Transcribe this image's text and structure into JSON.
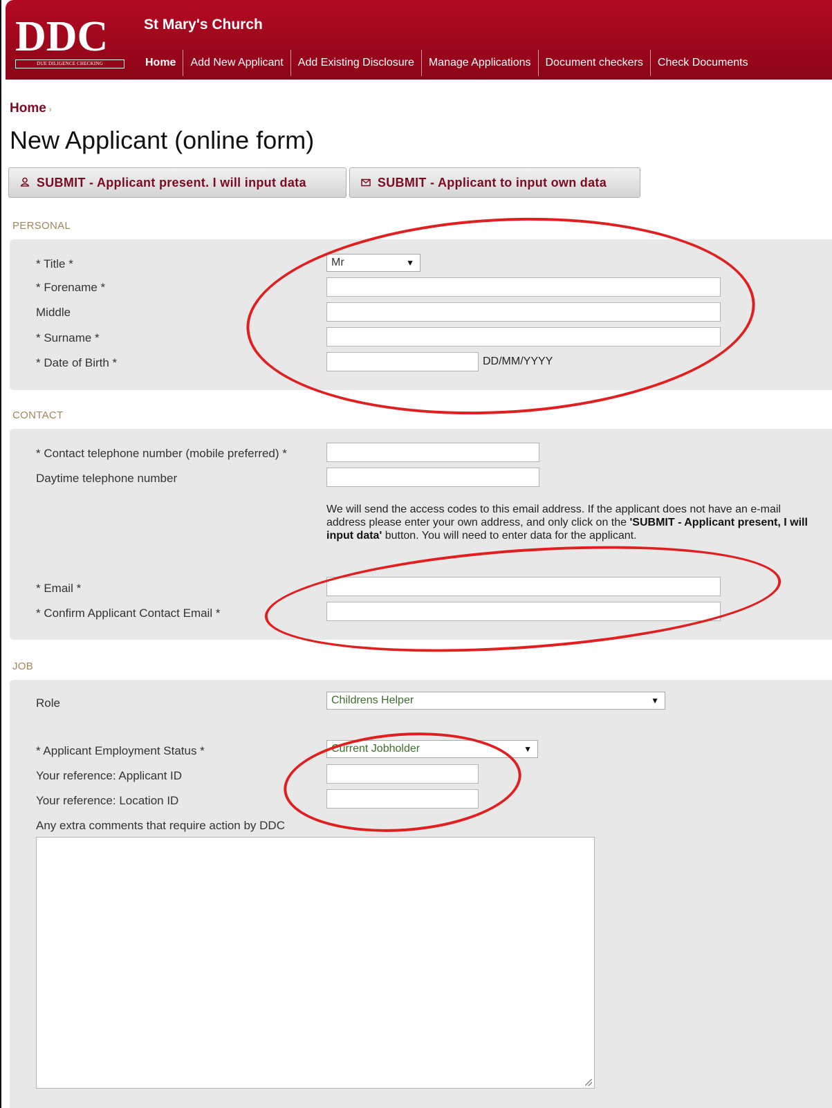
{
  "header": {
    "logo_text": "DDC",
    "logo_subtext": "DUE DILIGENCE CHECKING",
    "site_title": "St Mary's Church",
    "nav": [
      "Home",
      "Add New Applicant",
      "Add Existing Disclosure",
      "Manage Applications",
      "Document checkers",
      "Check Documents"
    ]
  },
  "breadcrumb": {
    "home": "Home",
    "arrow": "›"
  },
  "page_title": "New Applicant (online form)",
  "actions": {
    "submit_present": "SUBMIT - Applicant present. I will input data",
    "submit_own": "SUBMIT - Applicant to input own data"
  },
  "personal": {
    "section": "PERSONAL",
    "title_label": "* Title *",
    "title_value": "Mr",
    "forename_label": "* Forename *",
    "middle_label": "Middle",
    "surname_label": "* Surname *",
    "dob_label": "* Date of Birth *",
    "dob_hint": "DD/MM/YYYY"
  },
  "contact": {
    "section": "CONTACT",
    "phone_label": "* Contact telephone number (mobile preferred) *",
    "daytime_label": "Daytime telephone number",
    "note_pre": "We will send the access codes to this email address. If the applicant does not have an e-mail address please enter your own address, and only click on the ",
    "note_bold": "'SUBMIT - Applicant present, I will input data'",
    "note_post": " button. You will need to enter data for the applicant.",
    "email_label": "* Email *",
    "confirm_label": "* Confirm Applicant Contact Email *"
  },
  "job": {
    "section": "JOB",
    "role_label": "Role",
    "role_value": "Childrens Helper",
    "status_label": "* Applicant Employment Status *",
    "status_value": "Current Jobholder",
    "applicant_id_label": "Your reference: Applicant ID",
    "location_id_label": "Your reference: Location ID",
    "comments_label": "Any extra comments that require action by DDC"
  },
  "icons": {
    "user": "user-icon",
    "envelope": "envelope-icon",
    "dropdown": "chevron-down-icon"
  },
  "colors": {
    "brand": "#a0081d",
    "link": "#7a0b20",
    "annotation": "#e02020"
  }
}
